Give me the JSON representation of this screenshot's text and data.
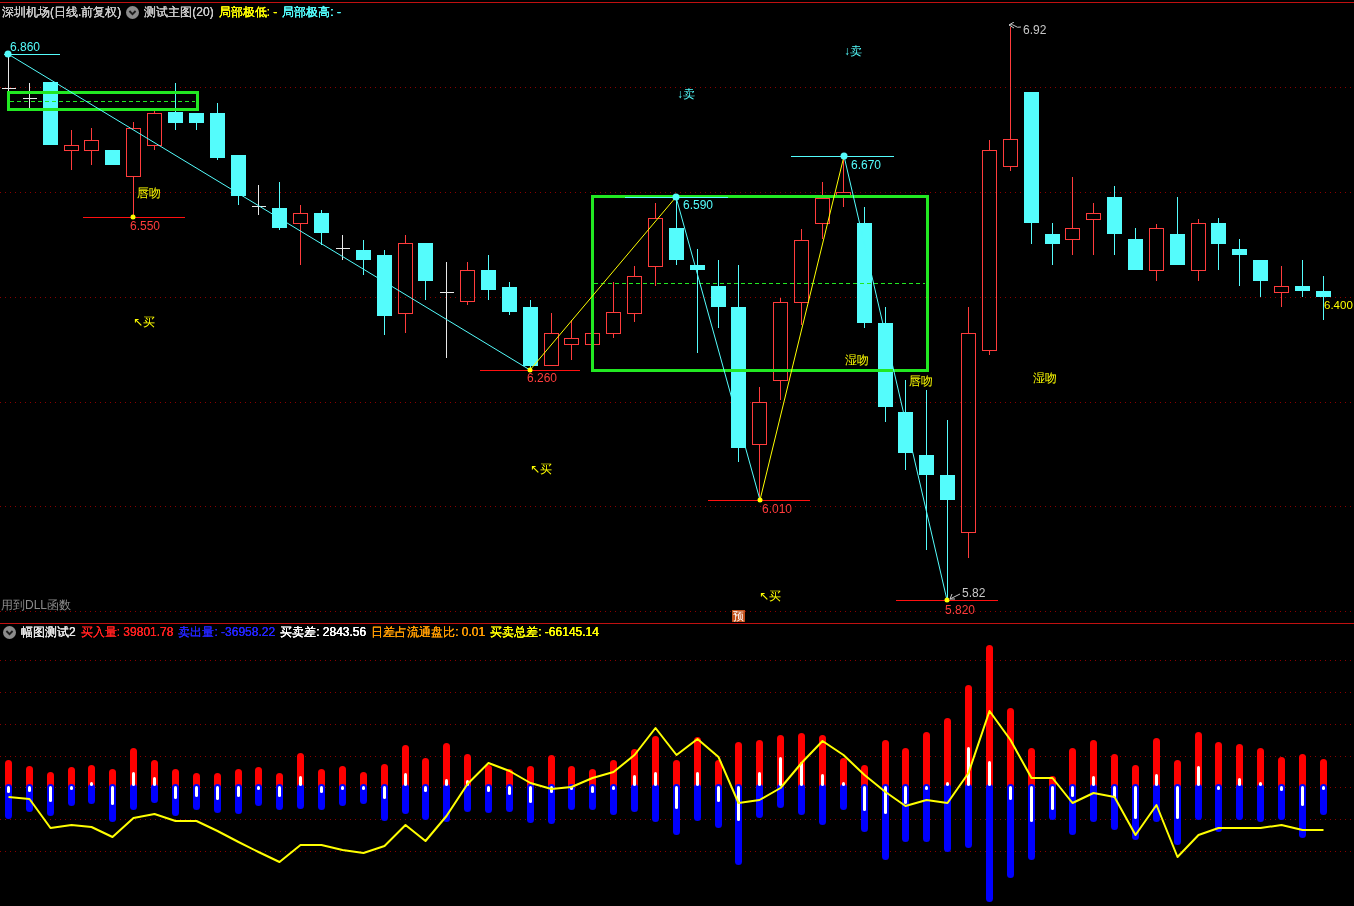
{
  "main_panel": {
    "title": "深圳机场(日线.前复权)",
    "indicator": "测试主图(20)",
    "legend": [
      {
        "text": "局部极低: -",
        "color": "#ffff00"
      },
      {
        "text": "局部极高: -",
        "color": "#54fcfc"
      }
    ],
    "price_labels": [
      {
        "kind": "high",
        "text": "6.860"
      },
      {
        "kind": "low",
        "text": "6.550"
      },
      {
        "kind": "low",
        "text": "6.260"
      },
      {
        "kind": "high",
        "text": "6.590"
      },
      {
        "kind": "high",
        "text": "6.670"
      },
      {
        "kind": "low",
        "text": "6.010"
      },
      {
        "kind": "low",
        "text": "5.820"
      },
      {
        "kind": "extreme",
        "text": "5.82"
      },
      {
        "kind": "extreme",
        "text": "6.92"
      },
      {
        "kind": "last",
        "text": "6.400"
      }
    ],
    "signals": [
      {
        "kind": "buy",
        "text": "↖买"
      },
      {
        "kind": "buy",
        "text": "↖买"
      },
      {
        "kind": "sell",
        "text": "↓卖"
      },
      {
        "kind": "buy",
        "text": "↖买"
      },
      {
        "kind": "sell",
        "text": "↓卖"
      }
    ],
    "patterns": [
      "唇吻",
      "湿吻",
      "唇吻",
      "湿吻"
    ],
    "badge": "预",
    "note": "用到DLL函数"
  },
  "sub_panel": {
    "indicator": "幅图测试2",
    "legend": [
      {
        "text": "买入量: 39801.78",
        "color": "#ff2020"
      },
      {
        "text": "卖出量: -36958.22",
        "color": "#2424ff"
      },
      {
        "text": "买卖差: 2843.56",
        "color": "#ffffff"
      },
      {
        "text": "日差占流通盘比: 0.01",
        "color": "#ff9c00"
      },
      {
        "text": "买卖总差: -66145.14",
        "color": "#ffff00"
      }
    ]
  }
}
